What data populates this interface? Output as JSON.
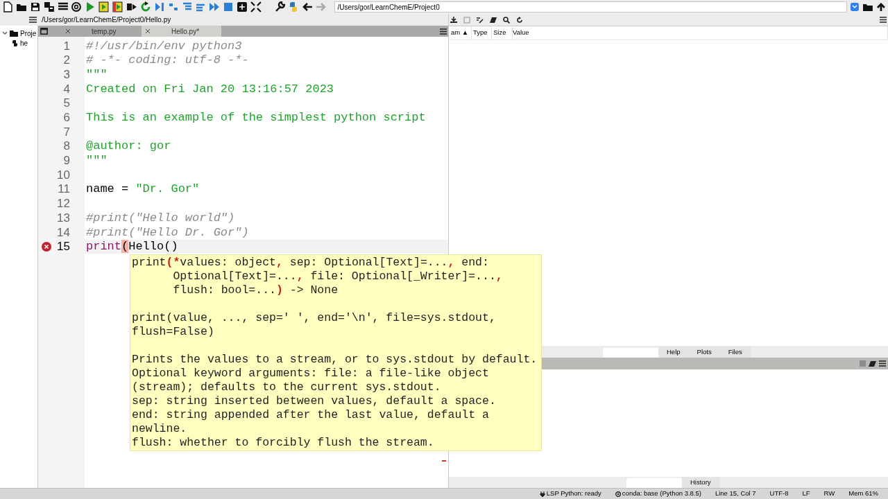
{
  "toolbar": {
    "path": "/Users/gor/LearnChemE/Project0"
  },
  "editor_path": "/Users/gor/LearnChemE/Project0/Hello.py",
  "file_explorer": {
    "items": [
      {
        "label": "Proje",
        "expanded": true,
        "children": [
          {
            "label": "he"
          }
        ]
      }
    ]
  },
  "editor": {
    "tabs": [
      {
        "label": "temp.py",
        "selected": false
      },
      {
        "label": "Hello.py*",
        "selected": true
      }
    ],
    "lines": [
      {
        "number": "1",
        "error": false,
        "current": false,
        "tokens": [
          {
            "text": "#!/usr/bin/env python3",
            "kind": "comment"
          }
        ]
      },
      {
        "number": "2",
        "error": false,
        "current": false,
        "tokens": [
          {
            "text": "# -*- coding: utf-8 -*-",
            "kind": "comment"
          }
        ]
      },
      {
        "number": "3",
        "error": false,
        "current": false,
        "tokens": [
          {
            "text": "\"\"\"",
            "kind": "string"
          }
        ]
      },
      {
        "number": "4",
        "error": false,
        "current": false,
        "tokens": [
          {
            "text": "Created on Fri Jan 20 13:16:57 2023",
            "kind": "string"
          }
        ]
      },
      {
        "number": "5",
        "error": false,
        "current": false
      },
      {
        "number": "6",
        "error": false,
        "current": false,
        "tokens": [
          {
            "text": "This is an example of the simplest python script",
            "kind": "string"
          }
        ]
      },
      {
        "number": "7",
        "error": false,
        "current": false
      },
      {
        "number": "8",
        "error": false,
        "current": false,
        "tokens": [
          {
            "text": "@author: gor",
            "kind": "string"
          }
        ]
      },
      {
        "number": "9",
        "error": false,
        "current": false,
        "tokens": [
          {
            "text": "\"\"\"",
            "kind": "string"
          }
        ]
      },
      {
        "number": "10",
        "error": false,
        "current": false
      },
      {
        "number": "11",
        "error": false,
        "current": false,
        "tokens": [
          {
            "text": "name = ",
            "kind": "plain"
          },
          {
            "text": "\"Dr. Gor\"",
            "kind": "string"
          }
        ]
      },
      {
        "number": "12",
        "error": false,
        "current": false
      },
      {
        "number": "13",
        "error": false,
        "current": false,
        "tokens": [
          {
            "text": "#print(\"Hello world\")",
            "kind": "comment"
          }
        ]
      },
      {
        "number": "14",
        "error": false,
        "current": false,
        "tokens": [
          {
            "text": "#print(\"Hello Dr. Gor\")",
            "kind": "comment"
          }
        ]
      },
      {
        "number": "15",
        "error": true,
        "current": true,
        "tokens": [
          {
            "text": "print",
            "kind": "builtin"
          },
          {
            "text": "(",
            "kind": "match"
          },
          {
            "text": "Hello()",
            "kind": "plain"
          }
        ]
      }
    ],
    "tooltip": {
      "paragraphs": [
        [
          [
            {
              "text": "print",
              "kind": "plain"
            },
            {
              "text": "(*",
              "kind": "red"
            },
            {
              "text": "values: object",
              "kind": "plain"
            },
            {
              "text": ",",
              "kind": "red"
            },
            {
              "text": " sep: Optional[Text]=...",
              "kind": "plain"
            },
            {
              "text": ",",
              "kind": "red"
            },
            {
              "text": " end:",
              "kind": "plain"
            }
          ],
          [
            {
              "text": "      Optional[Text]=...",
              "kind": "plain"
            },
            {
              "text": ",",
              "kind": "red"
            },
            {
              "text": " file: Optional[_Writer]=...",
              "kind": "plain"
            },
            {
              "text": ",",
              "kind": "red"
            }
          ],
          [
            {
              "text": "      flush: bool=...",
              "kind": "plain"
            },
            {
              "text": ")",
              "kind": "red"
            },
            {
              "text": " -> None",
              "kind": "plain"
            }
          ]
        ],
        [
          [
            {
              "text": "print(value, ..., sep=' ', end='\\n', file=sys.stdout,",
              "kind": "plain"
            }
          ],
          [
            {
              "text": "flush=False)",
              "kind": "plain"
            }
          ]
        ],
        [
          [
            {
              "text": "Prints the values to a stream, or to sys.stdout by default.",
              "kind": "plain"
            }
          ],
          [
            {
              "text": "Optional keyword arguments: file: a file-like object",
              "kind": "plain"
            }
          ],
          [
            {
              "text": "(stream); defaults to the current sys.stdout.",
              "kind": "plain"
            }
          ],
          [
            {
              "text": "sep: string inserted between values, default a space.",
              "kind": "plain"
            }
          ],
          [
            {
              "text": "end: string appended after the last value, default a",
              "kind": "plain"
            }
          ],
          [
            {
              "text": "newline.",
              "kind": "plain"
            }
          ],
          [
            {
              "text": "flush: whether to forcibly flush the stream.",
              "kind": "plain"
            }
          ]
        ]
      ]
    }
  },
  "variable_explorer": {
    "columns": [
      "am ▲",
      "Type",
      "Size",
      "Value"
    ]
  },
  "help_tabs": [
    {
      "label": "Help",
      "selected": false
    },
    {
      "label": "Plots",
      "selected": false
    },
    {
      "label": "Files",
      "selected": false
    }
  ],
  "console_tabs": [
    {
      "label": "History",
      "selected": false
    }
  ],
  "status_bar": [
    "LSP Python: ready",
    "conda: base (Python 3.8.5)",
    "Line 15, Col 7",
    "UTF-8",
    "LF",
    "RW",
    "Mem 61%"
  ]
}
